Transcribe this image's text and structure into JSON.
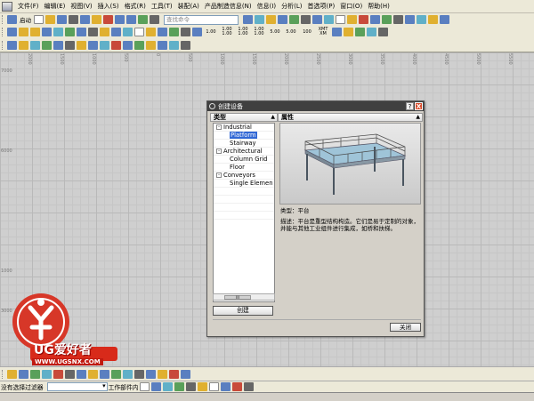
{
  "menubar": {
    "items": [
      "文件(F)",
      "编辑(E)",
      "视图(V)",
      "插入(S)",
      "格式(R)",
      "工具(T)",
      "装配(A)",
      "产品制造信息(N)",
      "信息(I)",
      "分析(L)",
      "首选项(P)",
      "窗口(O)",
      "帮助(H)"
    ]
  },
  "toolbar1": {
    "start_label": "启动",
    "search_placeholder": "查找命令"
  },
  "toolbar2": {
    "units": [
      "1.00",
      "1.00\n1.00",
      "1.00\n1.00",
      "1.00\n1.00",
      "5.00",
      "5.00",
      "100",
      "XMT\nXM"
    ]
  },
  "ruler": {
    "top": [
      "2000",
      "1500",
      "1000",
      "500",
      "0",
      "500",
      "1000",
      "1500",
      "2000",
      "2500",
      "3000",
      "3500",
      "4000",
      "4500",
      "5000",
      "5500",
      "6000"
    ],
    "left": [
      "7000",
      "",
      "6000",
      "",
      "",
      "1000",
      "3000",
      "4000",
      "5000"
    ]
  },
  "dialog": {
    "title": "创建设备",
    "help": "?",
    "close": "X",
    "type_header": "类型",
    "props_header": "属性",
    "tree": [
      {
        "kind": "group",
        "label": "Industrial"
      },
      {
        "kind": "child",
        "label": "Platform",
        "selected": true
      },
      {
        "kind": "child",
        "label": "Stairway"
      },
      {
        "kind": "group",
        "label": "Architectural"
      },
      {
        "kind": "child",
        "label": "Column Grid"
      },
      {
        "kind": "child",
        "label": "Floor"
      },
      {
        "kind": "group",
        "label": "Conveyors"
      },
      {
        "kind": "child",
        "label": "Single Elemen"
      }
    ],
    "scroll_label": "III",
    "create_label": "创建",
    "type_label": "类型：平台",
    "description": "描述：平台是重型结构构造。它们是易于定制的对象，并能与其他工业组件进行集成，如桥和扶梯。",
    "close_label": "关闭"
  },
  "logo": {
    "brand": "UG爱好者",
    "url": "WWW.UGSNX.COM"
  },
  "status": {
    "filter_label": "没有选择过滤器",
    "filter_select": "",
    "scope_text": "工作部件内"
  }
}
